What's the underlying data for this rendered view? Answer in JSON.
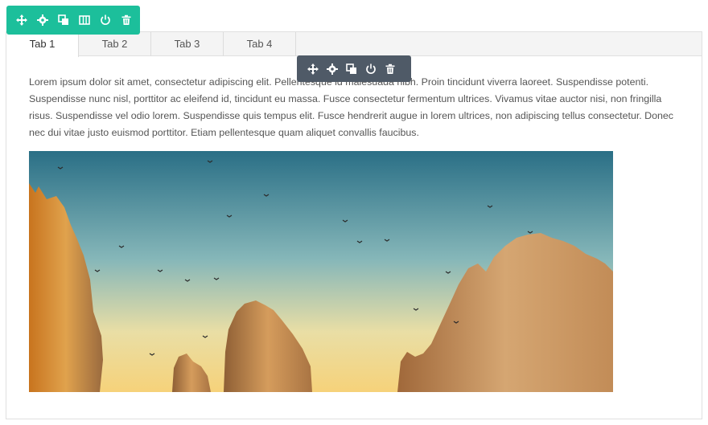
{
  "tabs": [
    {
      "label": "Tab 1",
      "active": true
    },
    {
      "label": "Tab 2",
      "active": false
    },
    {
      "label": "Tab 3",
      "active": false
    },
    {
      "label": "Tab 4",
      "active": false
    }
  ],
  "content": {
    "paragraph": "Lorem ipsum dolor sit amet, consectetur adipiscing elit. Pellentesque id malesuada nibh. Proin tincidunt viverra laoreet. Suspendisse potenti. Suspendisse nunc nisl, porttitor ac eleifend id, tincidunt eu massa. Fusce consectetur fermentum ultrices. Vivamus vitae auctor nisi, non fringilla risus. Suspendisse vel odio lorem. Suspendisse quis tempus elit. Fusce hendrerit augue in lorem ultrices, non adipiscing tellus consectetur. Donec nec dui vitae justo euismod porttitor. Etiam pellentesque quam aliquet convallis faucibus."
  },
  "module_toolbar": {
    "color": "#1cbf9b",
    "icons": [
      "move-icon",
      "settings-icon",
      "duplicate-icon",
      "columns-icon",
      "power-icon",
      "delete-icon"
    ]
  },
  "element_toolbar": {
    "color": "#4f5a67",
    "icons": [
      "move-icon",
      "settings-icon",
      "duplicate-icon",
      "power-icon",
      "delete-icon"
    ]
  }
}
